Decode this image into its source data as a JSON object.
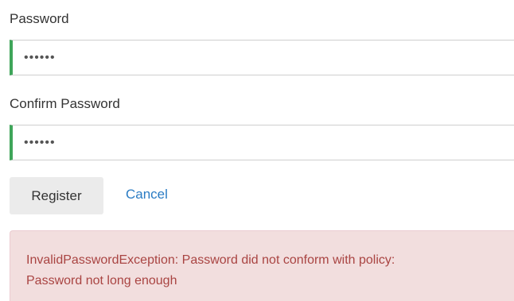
{
  "form": {
    "password_label": "Password",
    "password_value": "••••••",
    "confirm_label": "Confirm Password",
    "confirm_value": "••••••",
    "register_label": "Register",
    "cancel_label": "Cancel"
  },
  "error": {
    "line1": "InvalidPasswordException: Password did not conform with policy:",
    "line2": "Password not long enough"
  },
  "colors": {
    "valid_border": "#3fa55a",
    "link": "#2a7cc4",
    "alert_bg": "#f2dede",
    "alert_text": "#a94442"
  }
}
